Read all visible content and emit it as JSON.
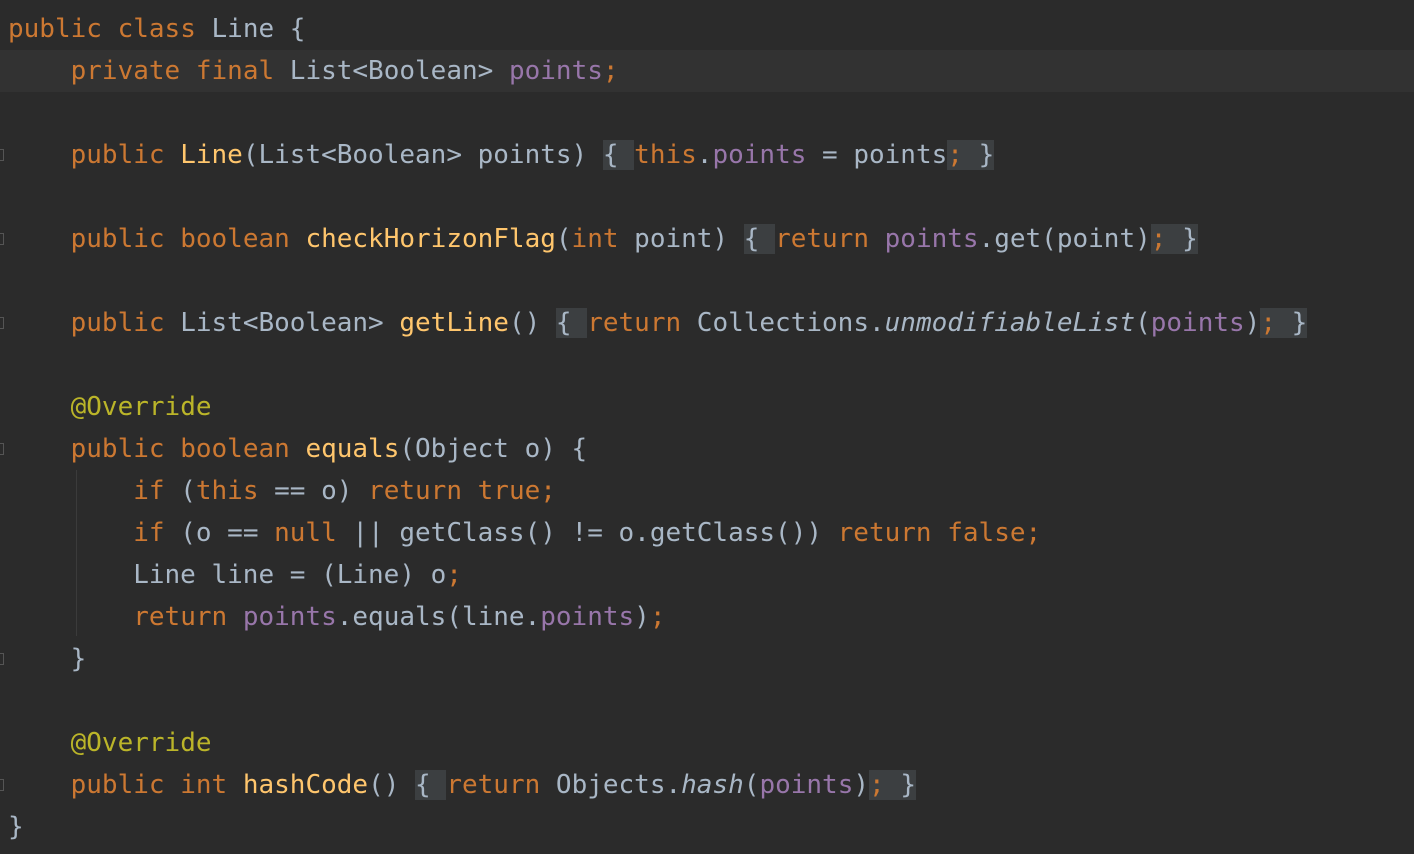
{
  "editor": {
    "language": "java",
    "theme_colors": {
      "background": "#2b2b2b",
      "current_line": "#323232",
      "keyword": "#cc7832",
      "field": "#9876aa",
      "method": "#ffc66d",
      "annotation": "#bbb529",
      "text": "#a9b7c6"
    },
    "lines": [
      "public class Line {",
      "    private final List<Boolean> points;",
      "",
      "    public Line(List<Boolean> points) { this.points = points; }",
      "",
      "    public boolean checkHorizonFlag(int point) { return points.get(point); }",
      "",
      "    public List<Boolean> getLine() { return Collections.unmodifiableList(points); }",
      "",
      "    @Override",
      "    public boolean equals(Object o) {",
      "        if (this == o) return true;",
      "        if (o == null || getClass() != o.getClass()) return false;",
      "        Line line = (Line) o;",
      "        return points.equals(line.points);",
      "    }",
      "",
      "    @Override",
      "    public int hashCode() { return Objects.hash(points); }",
      "}"
    ]
  }
}
